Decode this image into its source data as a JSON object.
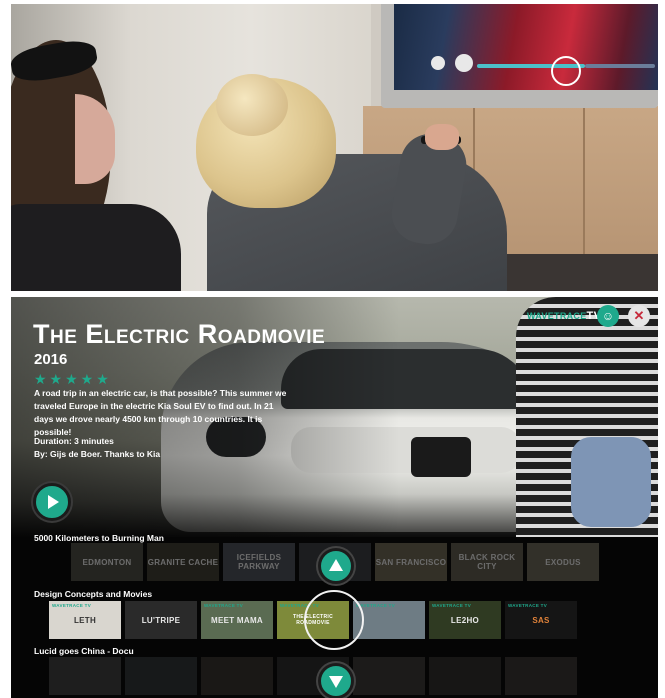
{
  "app": {
    "logo": {
      "brand": "WAVETRACE",
      "suffix": "TV"
    },
    "profile_icon": "user-icon",
    "close_icon": "close-icon"
  },
  "featured": {
    "title": "The Electric Roadmovie",
    "year": "2016",
    "rating": {
      "value": 5,
      "max": 5,
      "glyph": "★★★★★"
    },
    "description": "A road trip in an electric car, is that possible? This summer we traveled Europe in the electric Kia Soul EV to find out. In 21 days we drove nearly 4500 km through 10 countries. It is possible!",
    "duration": "Duration: 3 minutes",
    "credits": "By: Gijs de Boer. Thanks to Kia"
  },
  "rows": [
    {
      "label": "5000 Kilometers to Burning Man",
      "tiles": [
        "EDMONTON",
        "GRANITE CACHE",
        "ICEFIELDS PARKWAY",
        "",
        "SAN FRANCISCO",
        "BLACK ROCK CITY",
        "EXODUS"
      ]
    },
    {
      "label": "Design Concepts and Movies",
      "tiles": [
        "LETH",
        "LU'TRIPE",
        "MEET MAMA",
        "THE ELECTRIC ROADMOVIE",
        "",
        "LE2HO",
        "SAS"
      ],
      "tile_tag": "WAVETRACE TV"
    },
    {
      "label": "Lucid goes China - Docu",
      "tiles": [
        "",
        "",
        "",
        "",
        "",
        "",
        ""
      ]
    }
  ],
  "colors": {
    "accent": "#1fa98c",
    "close": "#c6283a",
    "background": "#050505"
  }
}
